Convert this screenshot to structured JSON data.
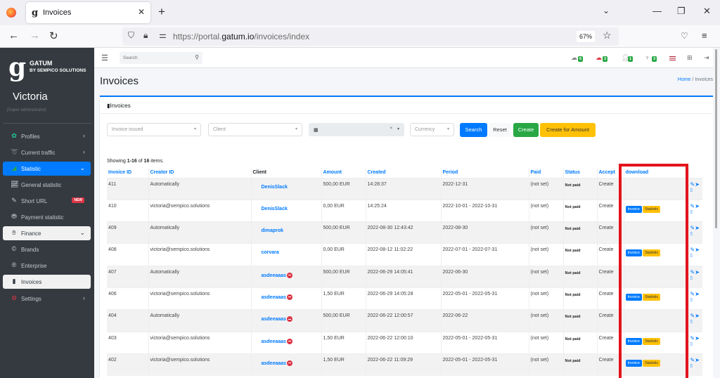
{
  "browser": {
    "tab_title": "Invoices",
    "tab_favicon": "gatum-g-icon",
    "url_prefix": "https://portal.",
    "url_domain": "gatum.io",
    "url_path": "/invoices/index",
    "zoom": "67%"
  },
  "sidebar": {
    "brand_name": "GATUM",
    "brand_sub": "BY SEMPICO SOLUTIONS",
    "user_name": "Victoria",
    "user_role": "[Super administrator]",
    "items": [
      {
        "label": "Profiles",
        "icon": "profiles-icon"
      },
      {
        "label": "Current traffic",
        "icon": "traffic-icon"
      },
      {
        "label": "Statistic",
        "icon": "chart-icon"
      },
      {
        "label": "General statistic",
        "icon": "line-chart-icon"
      },
      {
        "label": "Short URL",
        "icon": "pencil-icon",
        "badge": "NEW"
      },
      {
        "label": "Payment statistic",
        "icon": "payment-icon"
      },
      {
        "label": "Finance",
        "icon": "finance-icon"
      },
      {
        "label": "Brands",
        "icon": "copyright-icon"
      },
      {
        "label": "Enterprise",
        "icon": "registered-icon"
      },
      {
        "label": "Invoices",
        "icon": "invoice-icon"
      },
      {
        "label": "Settings",
        "icon": "gears-icon"
      }
    ]
  },
  "topnav": {
    "search_placeholder": "Search",
    "counters": [
      "6",
      "3",
      "1",
      "3"
    ]
  },
  "page": {
    "title": "Invoices",
    "breadcrumb_home": "Home",
    "breadcrumb_sep": "/",
    "breadcrumb_current": "Invoices",
    "card_title": "Invoices"
  },
  "filters": {
    "invoice_issued_placeholder": "Invoice issued",
    "client_placeholder": "Client",
    "currency_placeholder": "Currency",
    "search_label": "Search",
    "reset_label": "Reset",
    "create_label": "Create",
    "create_amount_label": "Create for Amount"
  },
  "summary": {
    "prefix": "Showing ",
    "range": "1-16",
    "mid": " of ",
    "total": "16",
    "suffix": " items."
  },
  "table": {
    "headers": [
      "Invoice ID",
      "Creator ID",
      "Client",
      "Amount",
      "Created",
      "Period",
      "Paid",
      "Status",
      "Accept",
      "download"
    ],
    "download_invoice_label": "Invoice",
    "download_statistic_label": "Statistic",
    "rows": [
      {
        "id": "411",
        "creator": "Automatically",
        "client": "DenisSlack",
        "blocked": false,
        "amount": "500,00 EUR",
        "created": "14:28:37",
        "period": "2022-12-31",
        "paid": "(not set)",
        "status": "Not paid",
        "accept": "Create",
        "download": false
      },
      {
        "id": "410",
        "creator": "victoria@sempico.solutions",
        "client": "DenisSlack",
        "blocked": false,
        "amount": "0,00 EUR",
        "created": "14:25:24",
        "period": "2022-10-01 - 2022-10-31",
        "paid": "(not set)",
        "status": "Not paid",
        "accept": "Create",
        "download": true
      },
      {
        "id": "409",
        "creator": "Automatically",
        "client": "dimaprok",
        "blocked": false,
        "amount": "500,00 EUR",
        "created": "2022-08-30 12:43:42",
        "period": "2022-08-30",
        "paid": "(not set)",
        "status": "Not paid",
        "accept": "Create",
        "download": false
      },
      {
        "id": "408",
        "creator": "victoria@sempico.solutions",
        "client": "corvara",
        "blocked": false,
        "amount": "0,00 EUR",
        "created": "2022-08-12 11:02:22",
        "period": "2022-07-01 - 2022-07-31",
        "paid": "(not set)",
        "status": "Not paid",
        "accept": "Create",
        "download": true
      },
      {
        "id": "407",
        "creator": "Automatically",
        "client": "asdeeaaas",
        "blocked": true,
        "amount": "500,00 EUR",
        "created": "2022-06-29 14:05:41",
        "period": "2022-06-30",
        "paid": "(not set)",
        "status": "Not paid",
        "accept": "Create",
        "download": false
      },
      {
        "id": "406",
        "creator": "victoria@sempico.solutions",
        "client": "asdeeaaas",
        "blocked": true,
        "amount": "1,50 EUR",
        "created": "2022-06-29 14:05:28",
        "period": "2022-05-01 - 2022-05-31",
        "paid": "(not set)",
        "status": "Not paid",
        "accept": "Create",
        "download": true
      },
      {
        "id": "404",
        "creator": "Automatically",
        "client": "asdeeaaas",
        "blocked": true,
        "amount": "500,00 EUR",
        "created": "2022-06-22 12:00:57",
        "period": "2022-06-22",
        "paid": "(not set)",
        "status": "Not paid",
        "accept": "Create",
        "download": false
      },
      {
        "id": "403",
        "creator": "victoria@sempico.solutions",
        "client": "asdeeaaas",
        "blocked": true,
        "amount": "1,50 EUR",
        "created": "2022-06-22 12:00:10",
        "period": "2022-05-01 - 2022-05-31",
        "paid": "(not set)",
        "status": "Not paid",
        "accept": "Create",
        "download": true
      },
      {
        "id": "402",
        "creator": "victoria@sempico.solutions",
        "client": "asdeeaaas",
        "blocked": true,
        "amount": "1,50 EUR",
        "created": "2022-06-22 11:09:29",
        "period": "2022-05-01 - 2022-05-31",
        "paid": "(not set)",
        "status": "Not paid",
        "accept": "Create",
        "download": true
      }
    ]
  },
  "colors": {
    "accent": "#007bff",
    "success": "#28a745",
    "warning": "#ffc107",
    "danger": "#dc3545",
    "sidebar_bg": "#343a40",
    "highlight": "#e3141c"
  }
}
